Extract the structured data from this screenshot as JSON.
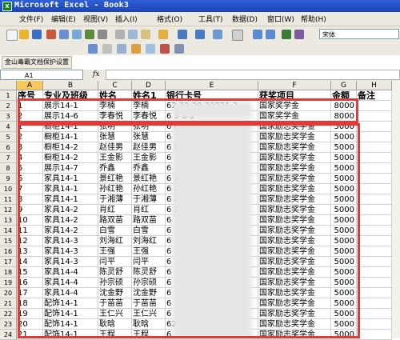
{
  "window": {
    "title": "Microsoft Excel - Book3"
  },
  "menu": [
    "文件(F)",
    "编辑(E)",
    "视图(V)",
    "插入(I)",
    "格式(O)",
    "工具(T)",
    "数据(D)",
    "窗口(W)",
    "帮助(H)"
  ],
  "toolbar": {
    "font_name": "宋体",
    "protect_button": "金山毒霸文档保护设置"
  },
  "formula_bar": {
    "name_box": "A1",
    "fx": "fx",
    "content": ""
  },
  "columns": [
    "A",
    "B",
    "C",
    "D",
    "E",
    "F",
    "G",
    "H"
  ],
  "header_row": [
    "序号",
    "专业及班级",
    "姓名",
    "姓名1",
    "银行卡号",
    "获奖项目",
    "金额",
    "备注"
  ],
  "rows": [
    [
      "1",
      "展示14-1",
      "李楠",
      "李楠",
      "62  22 29  30221 3",
      "国家奖学金",
      "8000"
    ],
    [
      "2",
      "展示14-6",
      "李春悦",
      "李春悦",
      "6             3  8 3",
      "国家奖学金",
      "8000"
    ],
    [
      "1",
      "橱柜14-1",
      "张明",
      "张明",
      "6          6",
      "国家励志奖学金",
      "5000"
    ],
    [
      "2",
      "橱柜14-1",
      "张慧",
      "张慧",
      "6        7",
      "国家励志奖学金",
      "5000"
    ],
    [
      "3",
      "橱柜14-2",
      "赵佳男",
      "赵佳男",
      "6        8",
      "国家励志奖学金",
      "5000"
    ],
    [
      "4",
      "橱柜14-2",
      "王金影",
      "王金影",
      "6",
      "国家励志奖学金",
      "5000"
    ],
    [
      "5",
      "展示14-7",
      "乔鑫",
      "乔鑫",
      "6",
      "国家励志奖学金",
      "5000"
    ],
    [
      "6",
      "家具14-1",
      "景红艳",
      "景红艳",
      "6      260",
      "国家励志奖学金",
      "5000"
    ],
    [
      "7",
      "家具14-1",
      "孙红艳",
      "孙红艳",
      "6      260",
      "国家励志奖学金",
      "5000"
    ],
    [
      "8",
      "家具14-1",
      "于湘薄",
      "于湘薄",
      "6      260",
      "国家励志奖学金",
      "5000"
    ],
    [
      "9",
      "家具14-2",
      "肖红",
      "肖红",
      "6      260",
      "国家励志奖学金",
      "5000"
    ],
    [
      "10",
      "家具14-2",
      "路双苗",
      "路双苗",
      "6",
      "国家励志奖学金",
      "5000"
    ],
    [
      "11",
      "家具14-2",
      "白雪",
      "白雪",
      "6",
      "国家励志奖学金",
      "5000"
    ],
    [
      "12",
      "家具14-3",
      "刘海红",
      "刘海红",
      "6",
      "国家励志奖学金",
      "5000"
    ],
    [
      "13",
      "家具14-3",
      "王强",
      "王强",
      "6",
      "国家励志奖学金",
      "5000"
    ],
    [
      "14",
      "家具14-3",
      "闫平",
      "闫平",
      "6",
      "国家励志奖学金",
      "5000"
    ],
    [
      "15",
      "家具14-4",
      "陈灵舒",
      "陈灵舒",
      "6",
      "国家励志奖学金",
      "5000"
    ],
    [
      "16",
      "家具14-4",
      "孙宗硕",
      "孙宗硕",
      "6",
      "国家励志奖学金",
      "5000"
    ],
    [
      "17",
      "家具14-4",
      "沈金野",
      "沈金野",
      "6",
      "国家励志奖学金",
      "5000"
    ],
    [
      "18",
      "配饰14-1",
      "于苗苗",
      "于苗苗",
      "6",
      "国家励志奖学金",
      "5000"
    ],
    [
      "19",
      "配饰14-1",
      "王仁兴",
      "王仁兴",
      "6",
      "国家励志奖学金",
      "5000"
    ],
    [
      "20",
      "配饰14-1",
      "耿晗",
      "耿晗",
      "621          021074",
      "国家励志奖学金",
      "5000"
    ],
    [
      "21",
      "配饰14-1",
      "王程",
      "王程",
      "6",
      "国家励志奖学金",
      "5000"
    ]
  ],
  "colors": {
    "highlight_box": "#e53935",
    "title_bar": "#1b43b8",
    "selected_header": "#f7c95a"
  }
}
